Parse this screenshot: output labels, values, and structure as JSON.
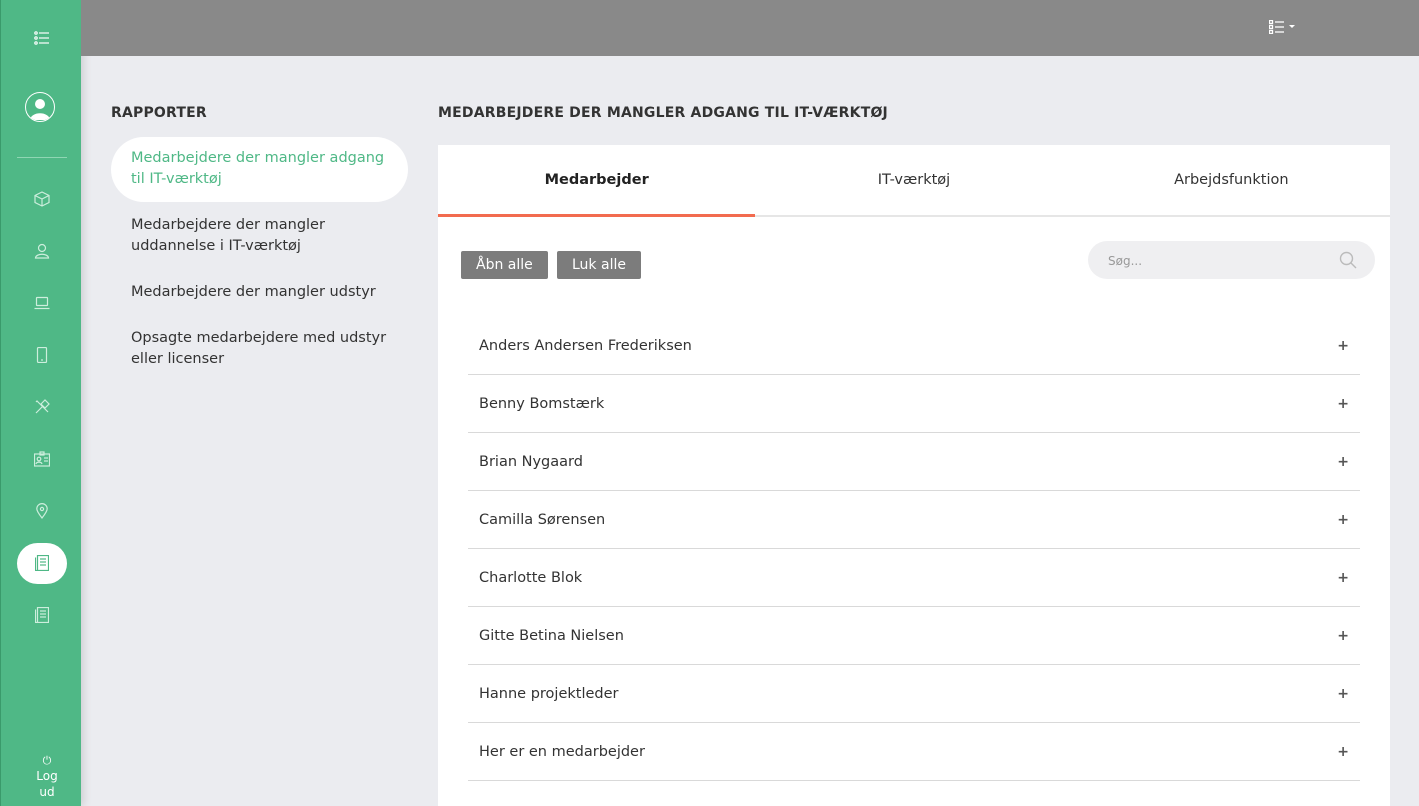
{
  "sidebar": {
    "items": [
      {
        "name": "sidebar-item-overview",
        "icon": "list-icon"
      },
      {
        "name": "sidebar-item-profile",
        "icon": "user-avatar-icon"
      },
      {
        "name": "sidebar-item-packages",
        "icon": "box-icon"
      },
      {
        "name": "sidebar-item-employees",
        "icon": "user-icon"
      },
      {
        "name": "sidebar-item-equipment",
        "icon": "laptop-icon"
      },
      {
        "name": "sidebar-item-devices",
        "icon": "mobile-icon"
      },
      {
        "name": "sidebar-item-tools",
        "icon": "tools-icon"
      },
      {
        "name": "sidebar-item-functions",
        "icon": "id-card-icon"
      },
      {
        "name": "sidebar-item-locations",
        "icon": "map-pin-icon"
      },
      {
        "name": "sidebar-item-reports",
        "icon": "report-icon"
      },
      {
        "name": "sidebar-item-logs",
        "icon": "document-icon"
      }
    ],
    "active_color": "#ffffff",
    "logout_label": "Log ud"
  },
  "topbar": {
    "menu_icon": "list-icon"
  },
  "reports": {
    "heading": "RAPPORTER",
    "items": [
      {
        "label": "Medarbejdere der mangler adgang til IT-værktøj",
        "active": true
      },
      {
        "label": "Medarbejdere der mangler uddannelse i IT-værktøj",
        "active": false
      },
      {
        "label": "Medarbejdere der mangler udstyr",
        "active": false
      },
      {
        "label": "Opsagte medarbejdere med udstyr eller licenser",
        "active": false
      }
    ]
  },
  "main": {
    "heading": "MEDARBEJDERE DER MANGLER ADGANG TIL IT-VÆRKTØJ",
    "tabs": [
      {
        "label": "Medarbejder",
        "active": true
      },
      {
        "label": "IT-værktøj",
        "active": false
      },
      {
        "label": "Arbejdsfunktion",
        "active": false
      }
    ],
    "open_all_label": "Åbn alle",
    "close_all_label": "Luk alle",
    "search": {
      "placeholder": "Søg...",
      "value": ""
    },
    "employees": [
      "Anders Andersen Frederiksen",
      "Benny Bomstærk",
      "Brian Nygaard",
      "Camilla Sørensen",
      "Charlotte Blok",
      "Gitte Betina Nielsen",
      "Hanne projektleder",
      "Her er en medarbejder"
    ],
    "toggle_symbol": "+"
  },
  "colors": {
    "brand_green": "#4fb886",
    "header_gray": "#898989",
    "tab_accent": "#f26b4f",
    "button_gray": "#7c7c7c",
    "page_bg": "#ebecf0"
  }
}
